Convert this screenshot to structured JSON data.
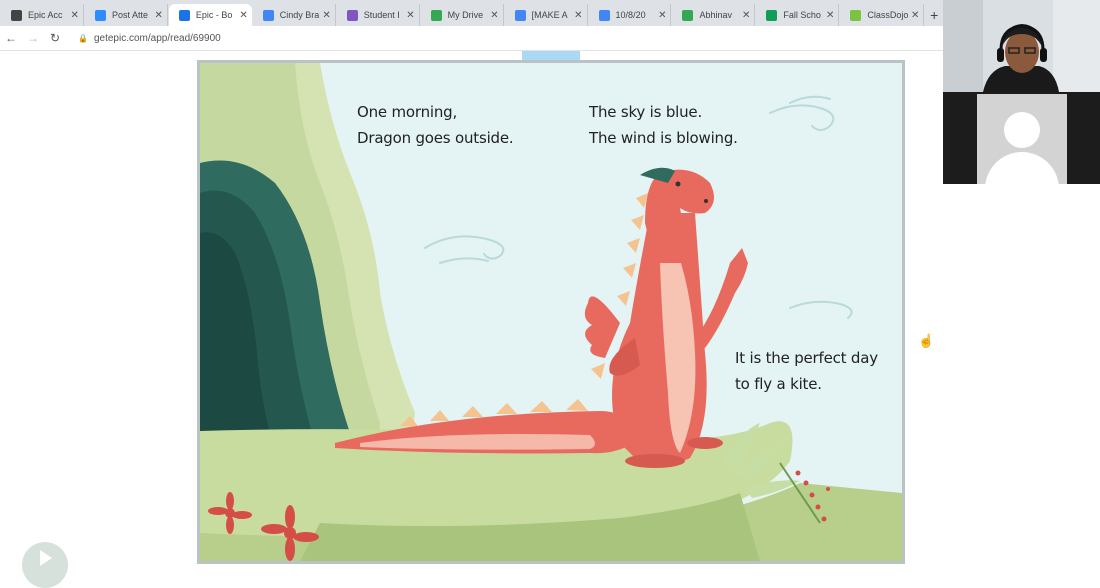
{
  "browser": {
    "tabs": [
      {
        "title": "Epic Acc",
        "favicon": "epic-icon",
        "color": "#444444",
        "active": false
      },
      {
        "title": "Post Atte",
        "favicon": "zoom-icon",
        "color": "#2d8cff",
        "active": false
      },
      {
        "title": "Epic - Bo",
        "favicon": "epic-icon",
        "color": "#1a73e8",
        "active": true
      },
      {
        "title": "Cindy Bra",
        "favicon": "docs-icon",
        "color": "#4285f4",
        "active": false
      },
      {
        "title": "Student I",
        "favicon": "forms-icon",
        "color": "#7e57c2",
        "active": false
      },
      {
        "title": "My Drive",
        "favicon": "drive-icon",
        "color": "#34a853",
        "active": false
      },
      {
        "title": "[MAKE A",
        "favicon": "docs-icon",
        "color": "#4285f4",
        "active": false
      },
      {
        "title": "10/8/20",
        "favicon": "docs-icon",
        "color": "#4285f4",
        "active": false
      },
      {
        "title": "Abhinav",
        "favicon": "drive-icon",
        "color": "#34a853",
        "active": false
      },
      {
        "title": "Fall Scho",
        "favicon": "sheets-icon",
        "color": "#0f9d58",
        "active": false
      },
      {
        "title": "ClassDojo",
        "favicon": "classdojo-icon",
        "color": "#7cc243",
        "active": false
      }
    ],
    "new_tab_label": "+",
    "url": "getepic.com/app/read/69900"
  },
  "book": {
    "text_left": [
      "One morning,",
      "Dragon goes outside."
    ],
    "text_right": [
      "The sky is blue.",
      "The wind is blowing."
    ],
    "text_bottom": [
      "It is the perfect day",
      "to fly a kite."
    ]
  },
  "colors": {
    "sky": "#e4f4f4",
    "dragon": "#e86a5e",
    "grass": "#c9dca0",
    "cave": "#2f6b5f"
  }
}
